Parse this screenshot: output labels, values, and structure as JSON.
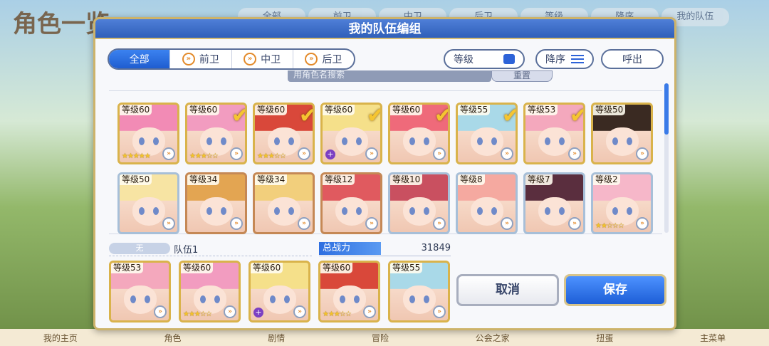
{
  "background": {
    "title": "角色一览",
    "tabs": [
      "全部",
      "前卫",
      "中卫",
      "后卫",
      "等级",
      "降序",
      "我的队伍"
    ],
    "bottom_nav": [
      "我的主页",
      "角色",
      "剧情",
      "冒险",
      "公会之家",
      "扭蛋",
      "主菜单"
    ]
  },
  "dialog": {
    "title": "我的队伍编组",
    "filter_tabs": [
      {
        "label": "全部",
        "active": true
      },
      {
        "label": "前卫",
        "icon": "chevron-right-icon"
      },
      {
        "label": "中卫",
        "icon": "chevron-right-icon"
      },
      {
        "label": "后卫",
        "icon": "chevron-right-icon"
      }
    ],
    "level_button": "等级",
    "sort_button": "降序",
    "call_button": "呼出",
    "search_placeholder": "用角色名搜索",
    "reset_button": "重置",
    "roster": [
      {
        "level": "等级60",
        "checked": false,
        "stars": 5,
        "frame": "gold",
        "hair": "#f28bb5"
      },
      {
        "level": "等级60",
        "checked": true,
        "stars": 3,
        "frame": "gold",
        "hair": "#f29cc0"
      },
      {
        "level": "等级60",
        "checked": true,
        "stars": 3,
        "frame": "gold",
        "hair": "#d9483a"
      },
      {
        "level": "等级60",
        "checked": true,
        "stars": 0,
        "frame": "gold",
        "plus": true,
        "hair": "#f5e08a"
      },
      {
        "level": "等级60",
        "checked": true,
        "stars": 0,
        "frame": "gold",
        "hair": "#ef6a7a"
      },
      {
        "level": "等级55",
        "checked": true,
        "stars": 0,
        "frame": "gold",
        "hair": "#a9d9e8"
      },
      {
        "level": "等级53",
        "checked": true,
        "stars": 0,
        "frame": "gold",
        "hair": "#f4a8bd"
      },
      {
        "level": "等级50",
        "checked": false,
        "stars": 0,
        "frame": "gold",
        "hair": "#3a2a22"
      },
      {
        "level": "等级50",
        "checked": false,
        "stars": 0,
        "frame": "silver",
        "hair": "#f7e4a3"
      },
      {
        "level": "等级34",
        "checked": false,
        "stars": 0,
        "frame": "bronze",
        "hair": "#e3a552"
      },
      {
        "level": "等级34",
        "checked": false,
        "stars": 0,
        "frame": "bronze",
        "hair": "#f2cf7c"
      },
      {
        "level": "等级12",
        "checked": false,
        "stars": 0,
        "frame": "bronze",
        "hair": "#e05a5f"
      },
      {
        "level": "等级10",
        "checked": false,
        "stars": 0,
        "frame": "silver",
        "hair": "#c95060"
      },
      {
        "level": "等级8",
        "checked": false,
        "stars": 0,
        "frame": "silver",
        "hair": "#f5a9a0"
      },
      {
        "level": "等级7",
        "checked": false,
        "stars": 0,
        "frame": "silver",
        "hair": "#5a2e3e"
      },
      {
        "level": "等级2",
        "checked": false,
        "stars": 2,
        "frame": "silver",
        "hair": "#f6b7c9"
      }
    ],
    "team_tag": "无",
    "team_name": "队伍1",
    "power_label": "总战力",
    "power_value": "31849",
    "team": [
      {
        "level": "等级53",
        "stars": 0,
        "hair": "#f4a8bd"
      },
      {
        "level": "等级60",
        "stars": 3,
        "hair": "#f29cc0"
      },
      {
        "level": "等级60",
        "stars": 0,
        "plus": true,
        "hair": "#f5e08a"
      },
      {
        "level": "等级60",
        "stars": 3,
        "hair": "#d9483a"
      },
      {
        "level": "等级55",
        "stars": 0,
        "hair": "#a9d9e8"
      }
    ],
    "cancel_button": "取消",
    "save_button": "保存"
  }
}
